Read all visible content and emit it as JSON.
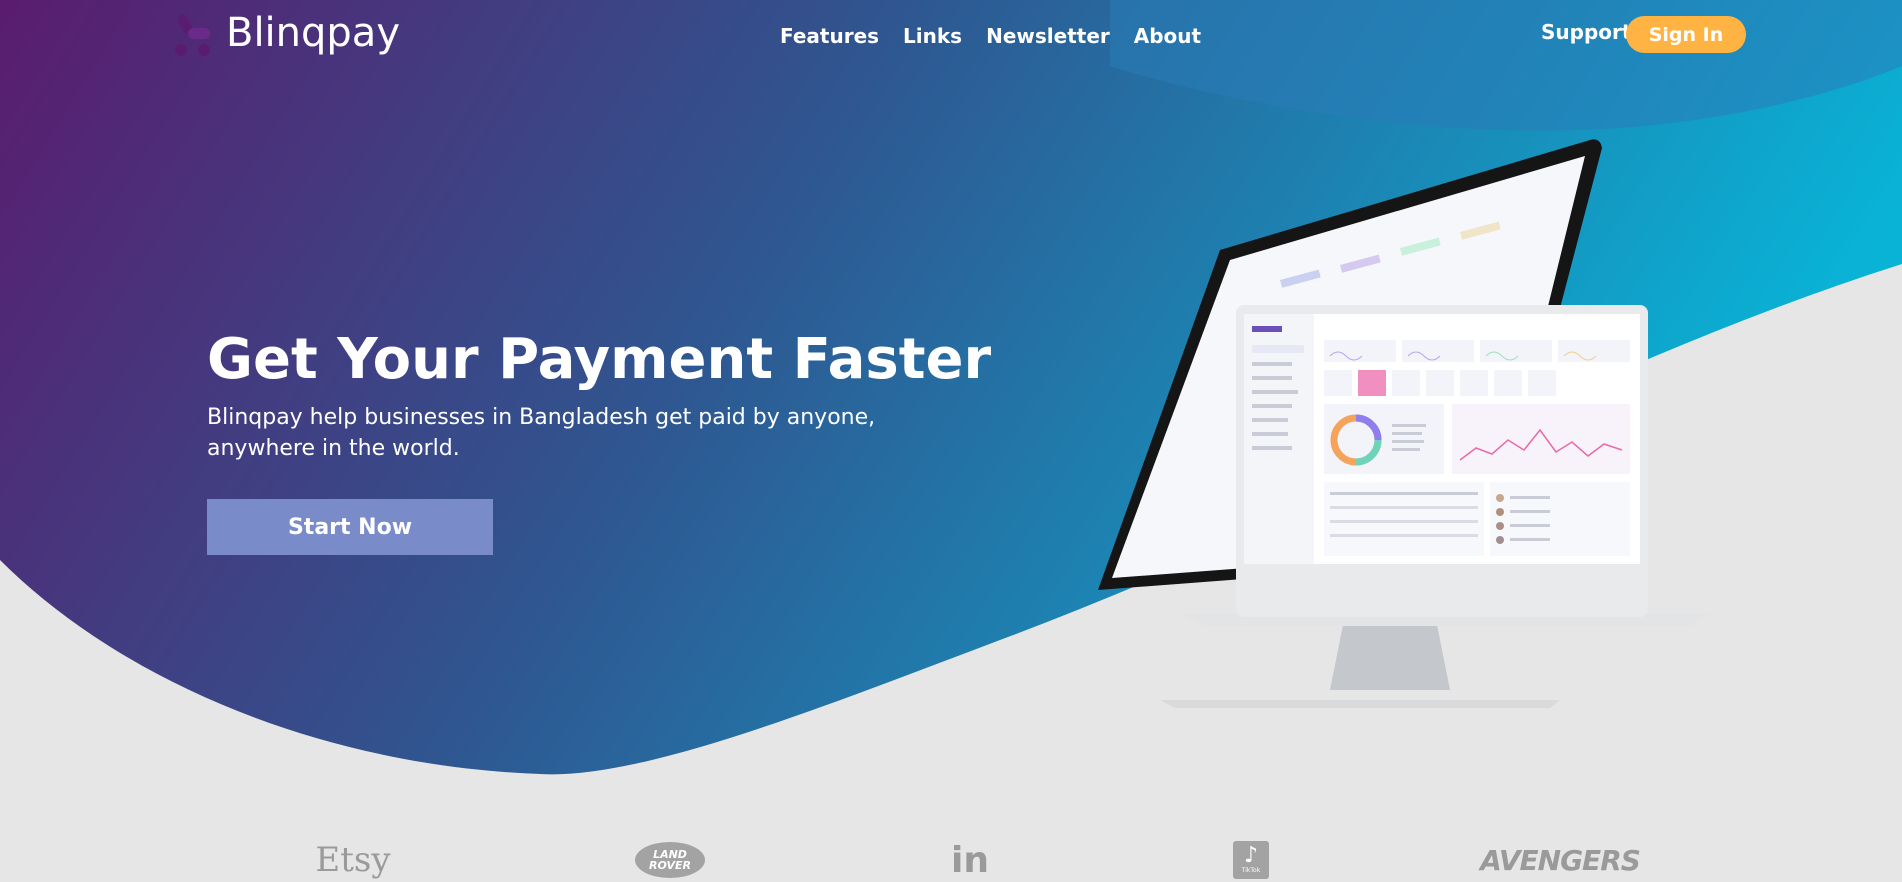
{
  "brand": {
    "name": "Blinqpay"
  },
  "nav": {
    "links": [
      "Features",
      "Links",
      "Newsletter",
      "About"
    ],
    "support": "Support",
    "sign_in": "Sign In"
  },
  "hero": {
    "title": "Get Your Payment Faster",
    "subtitle": "Blinqpay help businesses in Bangladesh get paid by anyone, anywhere in the world.",
    "cta": "Start Now"
  },
  "partners": {
    "etsy": "Etsy",
    "land_rover": "LAND ROVER",
    "linkedin": "in",
    "tiktok": "TikTok",
    "avengers": "AVENGERS"
  },
  "colors": {
    "gradient_start": "#5a1c6e",
    "gradient_mid": "#2d5a9a",
    "gradient_end": "#09b3d6",
    "sign_in_button": "#ffb343",
    "cta_button": "#7a8bca",
    "page_background": "#e6e6e6"
  },
  "icons": {
    "brand_logo": "blinqpay-logo-icon"
  }
}
